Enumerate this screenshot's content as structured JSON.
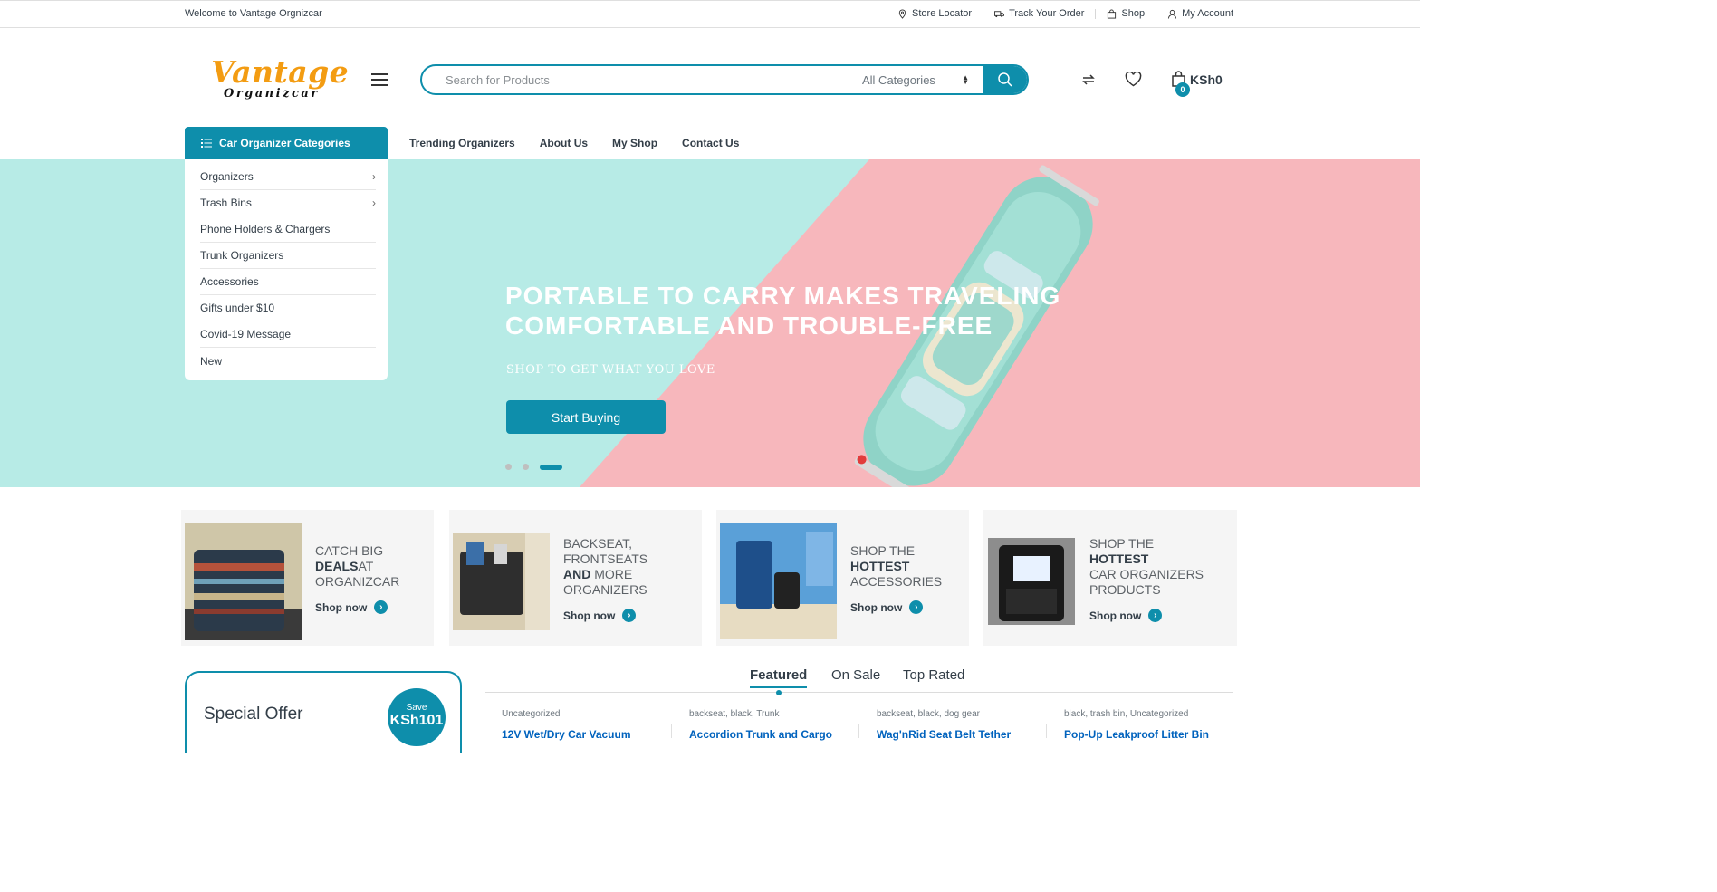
{
  "topbar": {
    "welcome": "Welcome to Vantage Orgnizcar",
    "links": [
      {
        "label": "Store Locator",
        "icon": "map-pin-icon"
      },
      {
        "label": "Track Your Order",
        "icon": "truck-icon"
      },
      {
        "label": "Shop",
        "icon": "shopping-bag-icon"
      },
      {
        "label": "My Account",
        "icon": "user-icon"
      }
    ]
  },
  "logo": {
    "main": "Vantage",
    "sub": "Organizcar"
  },
  "search": {
    "placeholder": "Search for Products",
    "category": "All Categories"
  },
  "cart": {
    "count": "0",
    "total": "KSh0"
  },
  "nav": {
    "categories_button": "Car Organizer Categories",
    "links": [
      "Trending Organizers",
      "About Us",
      "My Shop",
      "Contact Us"
    ]
  },
  "categories": [
    {
      "label": "Organizers",
      "has_sub": true
    },
    {
      "label": "Trash Bins",
      "has_sub": true
    },
    {
      "label": "Phone Holders & Chargers",
      "has_sub": false
    },
    {
      "label": "Trunk Organizers",
      "has_sub": false
    },
    {
      "label": "Accessories",
      "has_sub": false
    },
    {
      "label": "Gifts under $10",
      "has_sub": false
    },
    {
      "label": "Covid-19 Message",
      "has_sub": false
    },
    {
      "label": "New",
      "has_sub": false
    }
  ],
  "hero": {
    "title": "PORTABLE TO CARRY MAKES TRAVELING COMFORTABLE AND TROUBLE-FREE",
    "subtitle": "SHOP TO GET WHAT YOU LOVE",
    "button": "Start Buying",
    "slide_count": 3,
    "active_slide": 3
  },
  "promos": [
    {
      "l1": "CATCH BIG",
      "bold": "DEALS",
      "l2": "AT",
      "l3": "ORGANIZCAR",
      "cta": "Shop now"
    },
    {
      "l1": "BACKSEAT,",
      "l2": "FRONTSEATS",
      "bold": "AND",
      "l3": "MORE",
      "l4": "ORGANIZERS",
      "cta": "Shop now"
    },
    {
      "l1": "SHOP THE",
      "bold": "HOTTEST",
      "l2": "ACCESSORIES",
      "cta": "Shop now"
    },
    {
      "l1": "SHOP THE",
      "bold": "HOTTEST",
      "l2": "CAR ORGANIZERS",
      "l3": "PRODUCTS",
      "cta": "Shop now"
    }
  ],
  "offer": {
    "title": "Special Offer",
    "save_label": "Save",
    "save_amount": "KSh101"
  },
  "tabs": [
    "Featured",
    "On Sale",
    "Top Rated"
  ],
  "products": [
    {
      "category": "Uncategorized",
      "name": "12V Wet/Dry Car Vacuum"
    },
    {
      "category": "backseat, black, Trunk",
      "name": "Accordion Trunk and Cargo"
    },
    {
      "category": "backseat, black, dog gear",
      "name": "Wag'nRid Seat Belt Tether"
    },
    {
      "category": "black, trash bin, Uncategorized",
      "name": "Pop-Up Leakproof Litter Bin"
    }
  ],
  "colors": {
    "accent": "#0e8eab",
    "logo": "#f39c12",
    "hero_teal": "#b7ebe6",
    "hero_pink": "#f7b7bc"
  }
}
